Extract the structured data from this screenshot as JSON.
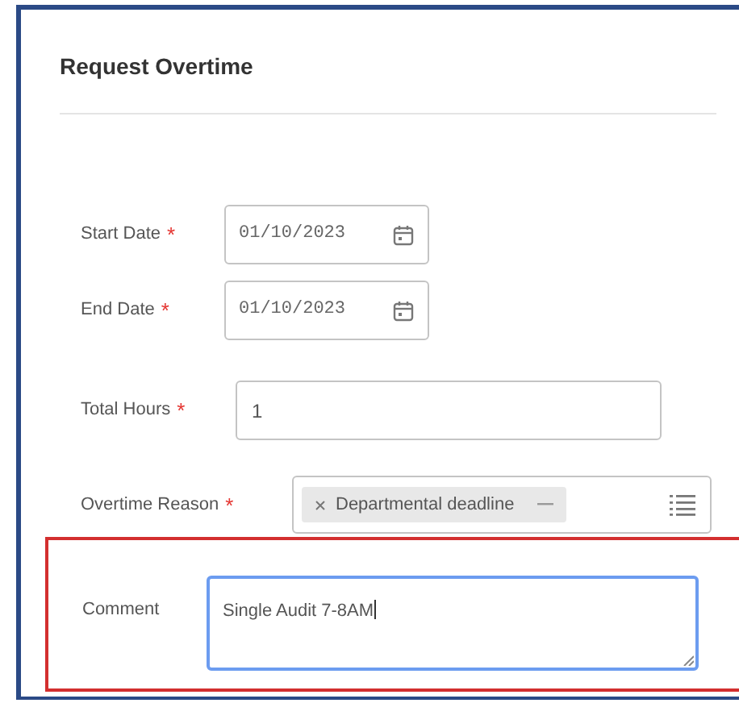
{
  "title": "Request Overtime",
  "required_symbol": "*",
  "fields": [
    {
      "kind": "date",
      "label": "Start Date",
      "required": true,
      "value": "01/10/2023"
    },
    {
      "kind": "date",
      "label": "End Date",
      "required": true,
      "value": "01/10/2023"
    },
    {
      "kind": "text",
      "label": "Total Hours",
      "required": true,
      "value": "1"
    },
    {
      "kind": "multiselect",
      "label": "Overtime Reason",
      "required": true,
      "chips": [
        "Departmental deadline"
      ]
    },
    {
      "kind": "textarea",
      "label": "Comment",
      "required": false,
      "value": "Single Audit 7-8AM",
      "focused": true,
      "highlighted": true
    }
  ]
}
